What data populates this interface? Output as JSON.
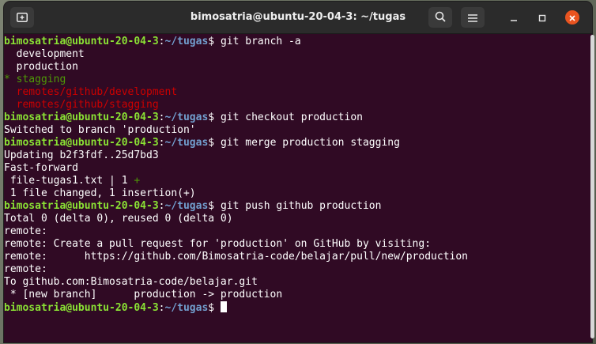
{
  "window": {
    "title": "bimosatria@ubuntu-20-04-3: ~/tugas"
  },
  "icons": [
    "new-tab-icon",
    "search-icon",
    "hamburger-menu-icon",
    "minimize-icon",
    "maximize-icon",
    "close-icon"
  ],
  "colors": {
    "terminal_bg": "#300a24",
    "prompt_user": "#8ae234",
    "prompt_path": "#729fcf",
    "current_branch": "#4e9a06",
    "remote_branch": "#cc0000",
    "close_button": "#e95420"
  },
  "prompt": {
    "user_host": "bimosatria@ubuntu-20-04-3",
    "sep": ":",
    "path": "~/tugas",
    "dollar": "$ "
  },
  "terminal": {
    "lines": [
      {
        "type": "prompt",
        "cmd": "git branch -a"
      },
      {
        "type": "out",
        "text": "  development"
      },
      {
        "type": "out",
        "text": "  production"
      },
      {
        "type": "out-green",
        "text": "* stagging"
      },
      {
        "type": "out-red",
        "text": "  remotes/github/development"
      },
      {
        "type": "out-red",
        "text": "  remotes/github/stagging"
      },
      {
        "type": "prompt",
        "cmd": "git checkout production"
      },
      {
        "type": "out",
        "text": "Switched to branch 'production'"
      },
      {
        "type": "prompt",
        "cmd": "git merge production stagging"
      },
      {
        "type": "out",
        "text": "Updating b2f3fdf..25d7bd3"
      },
      {
        "type": "out",
        "text": "Fast-forward"
      },
      {
        "type": "diffstat",
        "text": " file-tugas1.txt | 1 ",
        "plus": "+"
      },
      {
        "type": "out",
        "text": " 1 file changed, 1 insertion(+)"
      },
      {
        "type": "prompt",
        "cmd": "git push github production"
      },
      {
        "type": "out",
        "text": "Total 0 (delta 0), reused 0 (delta 0)"
      },
      {
        "type": "out",
        "text": "remote: "
      },
      {
        "type": "out",
        "text": "remote: Create a pull request for 'production' on GitHub by visiting:"
      },
      {
        "type": "out",
        "text": "remote:      https://github.com/Bimosatria-code/belajar/pull/new/production"
      },
      {
        "type": "out",
        "text": "remote: "
      },
      {
        "type": "out",
        "text": "To github.com:Bimosatria-code/belajar.git"
      },
      {
        "type": "out",
        "text": " * [new branch]      production -> production"
      },
      {
        "type": "prompt-cursor",
        "cmd": ""
      }
    ]
  }
}
